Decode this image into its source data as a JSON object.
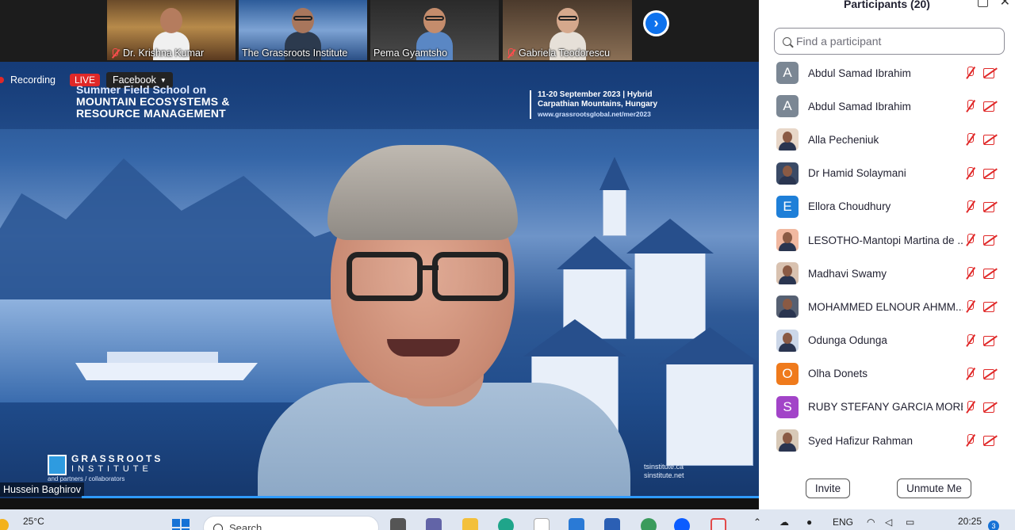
{
  "video_strip": {
    "tiles": [
      {
        "name": "Dr. Krishna Kumar",
        "muted": true
      },
      {
        "name": "The Grassroots Institute",
        "muted": false
      },
      {
        "name": "Pema Gyamtsho",
        "muted": false
      },
      {
        "name": "Gabriela Teodorescu",
        "muted": true
      }
    ]
  },
  "main_video": {
    "recording_label": "Recording",
    "live_label": "LIVE",
    "stream_target": "Facebook",
    "banner": {
      "line1": "Summer Field School on",
      "line2": "MOUNTAIN ECOSYSTEMS &",
      "line3": "RESOURCE MANAGEMENT",
      "event_line1": "11-20 September 2023 | Hybrid",
      "event_line2": "Carpathian Mountains, Hungary",
      "event_url": "www.grassrootsglobal.net/mer2023"
    },
    "logo": {
      "line1": "GRASSROOTS",
      "line2": "INSTITUTE",
      "line3": "and partners / collaborators"
    },
    "weblinks": [
      "tsinstitute.ca",
      "sinstitute.net"
    ],
    "speaker_name": "Hussein Baghirov"
  },
  "participants_panel": {
    "title": "Participants (20)",
    "search_placeholder": "Find a participant",
    "participants": [
      {
        "name": "Abdul Samad Ibrahim",
        "avatar": "A",
        "avatar_color": "#7b8794"
      },
      {
        "name": "Abdul Samad Ibrahim",
        "avatar": "A",
        "avatar_color": "#7b8794"
      },
      {
        "name": "Alla Pecheniuk",
        "avatar": "",
        "avatar_color": "#e8d7c8"
      },
      {
        "name": "Dr Hamid Solaymani",
        "avatar": "",
        "avatar_color": "#3a4a66"
      },
      {
        "name": "Ellora Choudhury",
        "avatar": "E",
        "avatar_color": "#1e7fd8"
      },
      {
        "name": "LESOTHO-Mantopi Martina de ...",
        "avatar": "",
        "avatar_color": "#f1b8a0"
      },
      {
        "name": "Madhavi Swamy",
        "avatar": "",
        "avatar_color": "#d9c2b0"
      },
      {
        "name": "MOHAMMED ELNOUR AHMM...",
        "avatar": "",
        "avatar_color": "#566072"
      },
      {
        "name": "Odunga Odunga",
        "avatar": "",
        "avatar_color": "#ccd7e8"
      },
      {
        "name": "Olha Donets",
        "avatar": "O",
        "avatar_color": "#ef7a1c"
      },
      {
        "name": "RUBY STEFANY GARCIA MORE...",
        "avatar": "S",
        "avatar_color": "#a244c8"
      },
      {
        "name": "Syed Hafizur Rahman",
        "avatar": "",
        "avatar_color": "#d8c9b7"
      }
    ],
    "invite_label": "Invite",
    "unmute_label": "Unmute Me"
  },
  "taskbar": {
    "temperature": "25°C",
    "search_label": "Search",
    "language": "ENG",
    "time": "20:25",
    "notification_count": "3"
  }
}
